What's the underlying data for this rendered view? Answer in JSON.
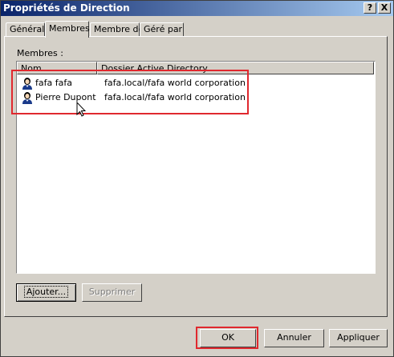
{
  "window": {
    "title": "Propriétés de Direction",
    "help_glyph": "?",
    "close_glyph": "X"
  },
  "tabs": [
    {
      "label": "Général",
      "active": false
    },
    {
      "label": "Membres",
      "active": true
    },
    {
      "label": "Membre de",
      "active": false
    },
    {
      "label": "Géré par",
      "active": false
    }
  ],
  "members": {
    "label": "Membres :",
    "columns": [
      "Nom",
      "Dossier Active Directory"
    ],
    "rows": [
      {
        "name": "fafa fafa",
        "folder": "fafa.local/fafa world corporation",
        "icon": "user-icon"
      },
      {
        "name": "Pierre Dupont",
        "folder": "fafa.local/fafa world corporation",
        "icon": "user-icon"
      }
    ],
    "add_button": "Ajouter...",
    "remove_button": "Supprimer"
  },
  "footer": {
    "ok": "OK",
    "cancel": "Annuler",
    "apply": "Appliquer"
  },
  "colors": {
    "titlebar_start": "#0a246a",
    "titlebar_end": "#a6caf0",
    "face": "#d4d0c8",
    "annotation": "#e0282e"
  }
}
